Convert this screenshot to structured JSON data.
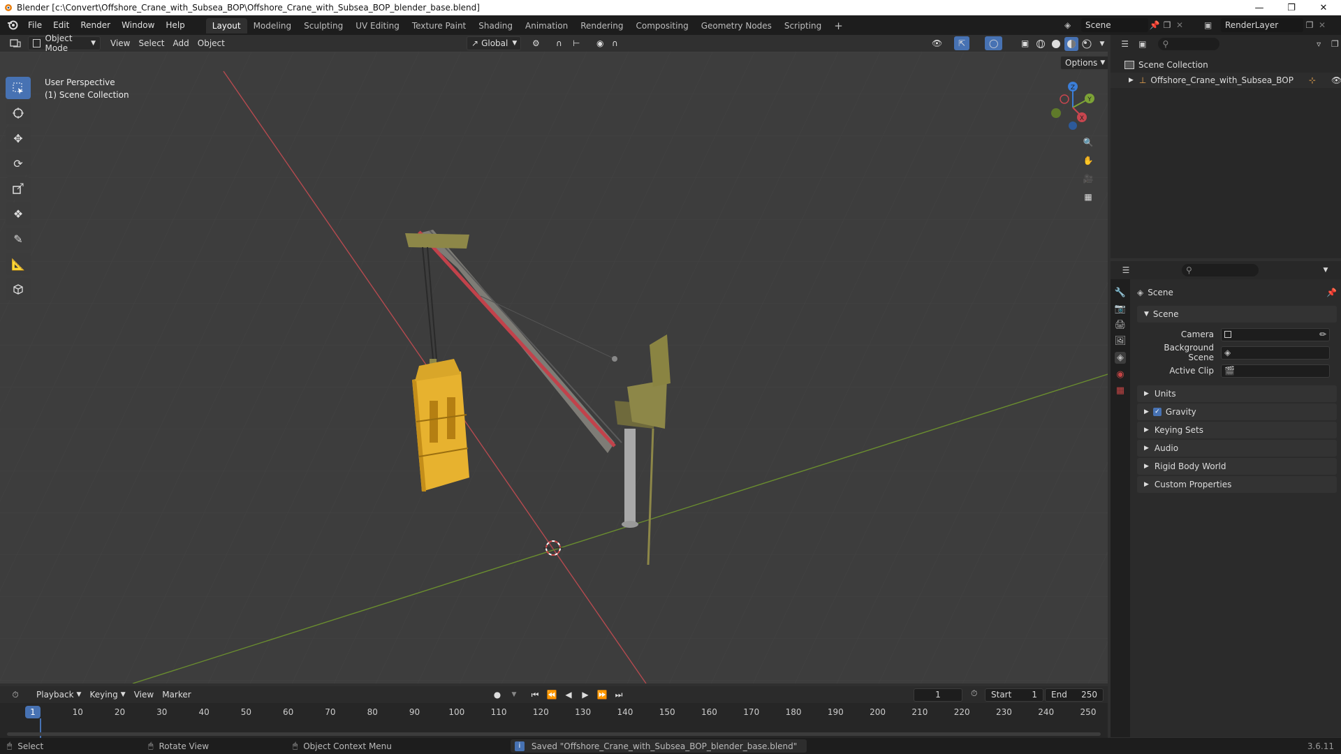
{
  "window": {
    "title": "Blender [c:\\Convert\\Offshore_Crane_with_Subsea_BOP\\Offshore_Crane_with_Subsea_BOP_blender_base.blend]"
  },
  "menu": [
    "File",
    "Edit",
    "Render",
    "Window",
    "Help"
  ],
  "workspaces": [
    {
      "label": "Layout",
      "active": true
    },
    {
      "label": "Modeling"
    },
    {
      "label": "Sculpting"
    },
    {
      "label": "UV Editing"
    },
    {
      "label": "Texture Paint"
    },
    {
      "label": "Shading"
    },
    {
      "label": "Animation"
    },
    {
      "label": "Rendering"
    },
    {
      "label": "Compositing"
    },
    {
      "label": "Geometry Nodes"
    },
    {
      "label": "Scripting"
    }
  ],
  "scene_selector": {
    "value": "Scene"
  },
  "renderlayer_selector": {
    "value": "RenderLayer"
  },
  "viewport_header": {
    "mode": "Object Mode",
    "menus": [
      "View",
      "Select",
      "Add",
      "Object"
    ],
    "orientation": "Global",
    "options": "Options"
  },
  "viewport": {
    "perspective": "User Perspective",
    "collection": "(1) Scene Collection",
    "gizmo_axes": {
      "x": "X",
      "y": "Y",
      "z": "Z"
    }
  },
  "outliner": {
    "root": "Scene Collection",
    "items": [
      "Offshore_Crane_with_Subsea_BOP"
    ]
  },
  "properties": {
    "header": "Scene",
    "panel_title": "Scene",
    "fields": [
      {
        "label": "Camera",
        "value": ""
      },
      {
        "label": "Background Scene",
        "value": ""
      },
      {
        "label": "Active Clip",
        "value": ""
      }
    ],
    "sections": [
      {
        "label": "Units"
      },
      {
        "label": "Gravity",
        "checkbox": true
      },
      {
        "label": "Keying Sets"
      },
      {
        "label": "Audio"
      },
      {
        "label": "Rigid Body World"
      },
      {
        "label": "Custom Properties"
      }
    ]
  },
  "timeline": {
    "menus": [
      "Playback",
      "Keying",
      "View",
      "Marker"
    ],
    "current_frame": "1",
    "start_label": "Start",
    "start": "1",
    "end_label": "End",
    "end": "250",
    "ticks": [
      "1",
      "10",
      "20",
      "30",
      "40",
      "50",
      "60",
      "70",
      "80",
      "90",
      "100",
      "110",
      "120",
      "130",
      "140",
      "150",
      "160",
      "170",
      "180",
      "190",
      "200",
      "210",
      "220",
      "230",
      "240",
      "250"
    ]
  },
  "statusbar": {
    "select": "Select",
    "rotate": "Rotate View",
    "context": "Object Context Menu",
    "message": "Saved \"Offshore_Crane_with_Subsea_BOP_blender_base.blend\"",
    "version": "3.6.11"
  },
  "colors": {
    "accent": "#4772b3",
    "x_axis": "#c8464f",
    "y_axis": "#7da336",
    "z_axis": "#3b7ed8",
    "bop_yellow": "#e7b22f"
  }
}
